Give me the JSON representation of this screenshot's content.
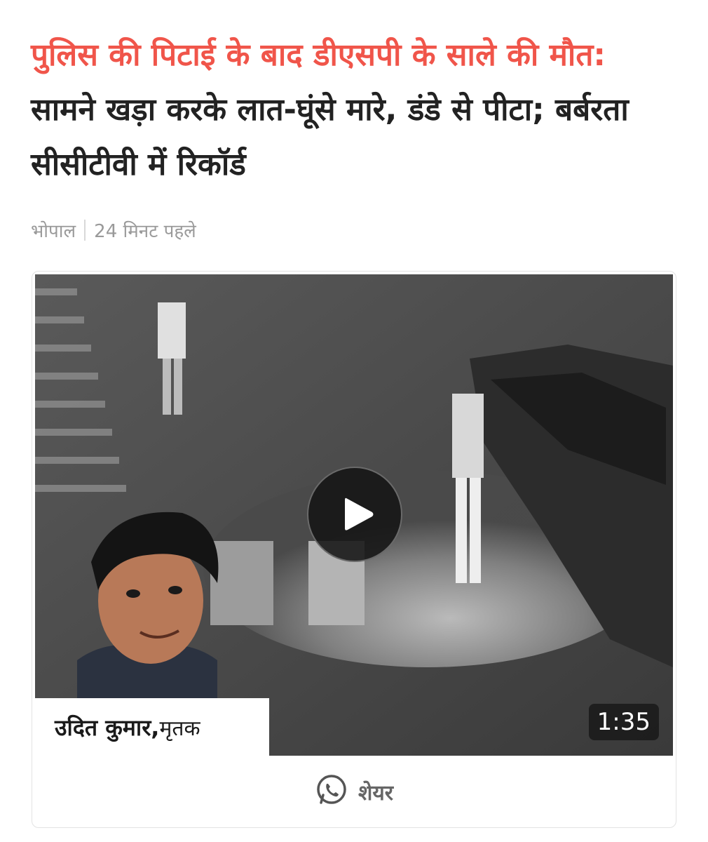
{
  "article": {
    "headline_kicker": "पुलिस की पिटाई के बाद डीएसपी के साले की मौत:",
    "headline_rest": " सामने खड़ा करके लात-घूंसे मारे, डंडे से पीटा; बर्बरता सीसीटीवी में रिकॉर्ड",
    "location": "भोपाल",
    "time_ago": "24 मिनट पहले"
  },
  "video": {
    "duration": "1:35",
    "caption_name": "उदित कुमार,",
    "caption_role": " मृतक",
    "play_icon": "play-icon"
  },
  "share": {
    "label": "शेयर",
    "icon": "whatsapp-icon"
  },
  "colors": {
    "kicker": "#f0554a",
    "text": "#222222",
    "meta": "#9a9a9a"
  }
}
